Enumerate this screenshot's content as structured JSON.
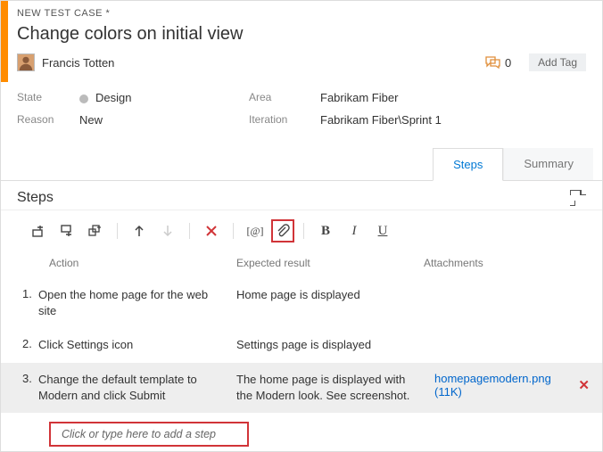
{
  "header": {
    "type_label": "NEW TEST CASE *",
    "title": "Change colors on initial view",
    "assignee": "Francis Totten",
    "discussion_count": "0",
    "add_tag": "Add Tag"
  },
  "meta": {
    "state_label": "State",
    "state_value": "Design",
    "reason_label": "Reason",
    "reason_value": "New",
    "area_label": "Area",
    "area_value": "Fabrikam Fiber",
    "iteration_label": "Iteration",
    "iteration_value": "Fabrikam Fiber\\Sprint 1"
  },
  "tabs": {
    "steps": "Steps",
    "summary": "Summary"
  },
  "section": {
    "title": "Steps"
  },
  "columns": {
    "action": "Action",
    "expected": "Expected result",
    "attachments": "Attachments"
  },
  "steps": [
    {
      "num": "1.",
      "action": "Open the home page for the web site",
      "expected": "Home page is displayed"
    },
    {
      "num": "2.",
      "action": "Click Settings icon",
      "expected": "Settings page is displayed"
    },
    {
      "num": "3.",
      "action": "Change the default template to Modern and click Submit",
      "expected": "The home page is displayed with the Modern look. See screenshot.",
      "attachment": "homepagemodern.png (11K)"
    }
  ],
  "add_step_placeholder": "Click or type here to add a step",
  "format": {
    "b": "B",
    "i": "I",
    "u": "U",
    "at": "[@]"
  }
}
